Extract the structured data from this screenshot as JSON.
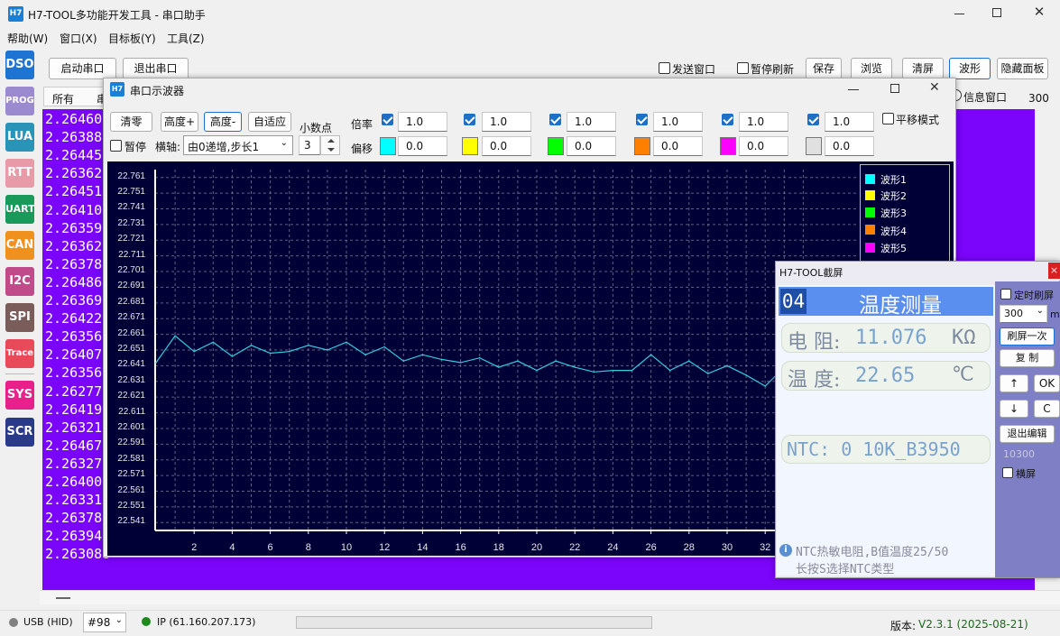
{
  "app": {
    "icon": "H7",
    "title": "H7-TOOL多功能开发工具 - 串口助手"
  },
  "menu": [
    "帮助(W)",
    "窗口(X)",
    "目标板(Y)",
    "工具(Z)"
  ],
  "sidebar": [
    "DSO",
    "PROG",
    "LUA",
    "RTT",
    "UART",
    "CAN",
    "I2C",
    "SPI",
    "Trace",
    "SYS",
    "SCR"
  ],
  "toolbar": {
    "start": "启动串口",
    "exit": "退出串口",
    "send_window": "发送窗口",
    "pause_refresh": "暂停刷新",
    "save": "保存",
    "browse": "浏览",
    "clear": "清屏",
    "wave": "波形",
    "hide_panel": "隐藏面板",
    "info_window": "信息窗口",
    "count": "300"
  },
  "tabs": [
    "所有",
    "串"
  ],
  "terminal": [
    "2.264600",
    "2.263889",
    "2.264458",
    "2.263627",
    "2.264515",
    "2.264103",
    "2.263597",
    "2.263621",
    "2.263780",
    "2.264863",
    "2.263690",
    "2.264221",
    "2.263564",
    "2.264070",
    "2.263564",
    "2.262774",
    "2.264198",
    "2.263211",
    "2.264675",
    "2.263276",
    "2.264007",
    "2.263310",
    "2.263786",
    "2.263948",
    "2.263088"
  ],
  "scope": {
    "icon": "H7",
    "title": "串口示波器",
    "zero": "清零",
    "height_plus": "高度+",
    "height_minus": "高度-",
    "auto_fit": "自适应",
    "decimal_label": "小数点",
    "decimal_value": "3",
    "pause": "暂停",
    "axis_label": "横轴:",
    "axis_value": "由0递增,步长1",
    "rate_label": "倍率",
    "offset_label": "偏移",
    "shift_mode": "平移模式",
    "channels": [
      {
        "rate": "1.0",
        "offset": "0.0",
        "color": "#00ffff"
      },
      {
        "rate": "1.0",
        "offset": "0.0",
        "color": "#ffff00"
      },
      {
        "rate": "1.0",
        "offset": "0.0",
        "color": "#00ff00"
      },
      {
        "rate": "1.0",
        "offset": "0.0",
        "color": "#ff8000"
      },
      {
        "rate": "1.0",
        "offset": "0.0",
        "color": "#ff00ff"
      },
      {
        "rate": "1.0",
        "offset": "0.0",
        "color": "#e0e0e0"
      }
    ],
    "legend": [
      "波形1",
      "波形2",
      "波形3",
      "波形4",
      "波形5"
    ]
  },
  "chart_data": {
    "type": "line",
    "ylim": [
      22.536,
      22.766
    ],
    "y_ticks": [
      "22.761",
      "22.751",
      "22.741",
      "22.731",
      "22.721",
      "22.711",
      "22.701",
      "22.691",
      "22.681",
      "22.671",
      "22.661",
      "22.651",
      "22.641",
      "22.631",
      "22.621",
      "22.611",
      "22.601",
      "22.591",
      "22.581",
      "22.571",
      "22.561",
      "22.551",
      "22.541"
    ],
    "x_ticks": [
      "2",
      "4",
      "6",
      "8",
      "10",
      "12",
      "14",
      "16",
      "18",
      "20",
      "22",
      "24",
      "26",
      "28",
      "30",
      "32"
    ],
    "series": [
      {
        "name": "波形1",
        "color": "#33ccdd",
        "x": [
          0,
          1,
          2,
          3,
          4,
          5,
          6,
          7,
          8,
          9,
          10,
          11,
          12,
          13,
          14,
          15,
          16,
          17,
          18,
          19,
          20,
          21,
          22,
          23,
          24,
          25,
          26,
          27,
          28,
          29,
          30,
          31,
          32,
          33,
          34
        ],
        "values": [
          22.643,
          22.66,
          22.65,
          22.656,
          22.647,
          22.654,
          22.649,
          22.65,
          22.654,
          22.651,
          22.656,
          22.648,
          22.653,
          22.644,
          22.648,
          22.645,
          22.643,
          22.646,
          22.64,
          22.644,
          22.638,
          22.644,
          22.64,
          22.637,
          22.638,
          22.638,
          22.648,
          22.638,
          22.644,
          22.636,
          22.641,
          22.635,
          22.628,
          22.64,
          22.653
        ]
      }
    ]
  },
  "screenshot": {
    "title": "H7-TOOL截屏",
    "close": "×",
    "lcd": {
      "page": "04",
      "heading": "温度测量",
      "line1_label": "电 阻:",
      "line1_value": "11.076",
      "line1_unit": "KΩ",
      "line2_label": "温 度:",
      "line2_value": "22.65",
      "line2_unit": "℃",
      "line3": "NTC: 0 10K_B3950",
      "info_icon": "i",
      "hint1": "NTC热敏电阻,B值温度25/50",
      "hint2": "长按S选择NTC类型"
    },
    "timed_refresh": "定时刷屏",
    "interval": "300",
    "interval_unit": "m",
    "refresh_once": "刷屏一次",
    "copy": "复 制",
    "up": "↑",
    "ok": "OK",
    "down": "↓",
    "c": "C",
    "exit_edit": "退出编辑",
    "code": "10300",
    "landscape": "横屏"
  },
  "status": {
    "usb": "USB (HID)",
    "port": "#98",
    "ip": "IP (61.160.207.173)",
    "version_label": "版本:",
    "version": "V2.3.1 (2025-08-21)",
    "usb_color": "#808080",
    "ip_color": "#1a8a1a"
  }
}
